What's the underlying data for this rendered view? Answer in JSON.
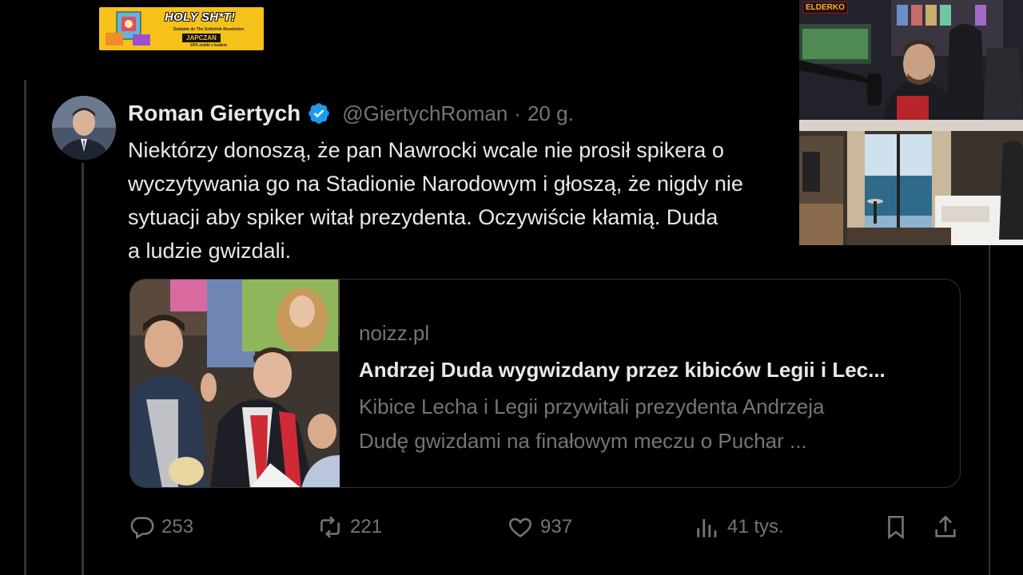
{
  "sponsor": {
    "title": "HOLY SH*T!",
    "subtitle": "Dodatek do The Softdrink Revolution",
    "brand": "JAPCZAN",
    "note": "10% zniżki z kodem"
  },
  "tweet": {
    "author_name": "Roman Giertych",
    "handle": "@GiertychRoman",
    "separator": "·",
    "time": "20 g.",
    "text_lines": [
      "Niektórzy donoszą, że pan Nawrocki wcale nie prosił spikera o",
      "wyczytywania go na Stadionie Narodowym i głoszą, że nigdy nie",
      "sytuacji aby spiker witał prezydenta. Oczywiście kłamią. Duda",
      "a ludzie gwizdali."
    ]
  },
  "link_card": {
    "domain": "noizz.pl",
    "title": "Andrzej Duda wygwizdany przez kibiców Legii i Lec...",
    "description_lines": [
      "Kibice Lecha i Legii przywitali prezydenta Andrzeja",
      "Dudę gwizdami na finałowym meczu o Puchar ..."
    ]
  },
  "actions": {
    "replies": "253",
    "reposts": "221",
    "likes": "937",
    "views": "41 tys."
  },
  "overlay": {
    "channel_badge": "ELDERKO"
  },
  "colors": {
    "background": "#000000",
    "text_primary": "#e7e9ea",
    "text_secondary": "#71767b",
    "verified_blue": "#1d9bf0",
    "border": "#2f3336",
    "sponsor_yellow": "#f6c21a"
  }
}
